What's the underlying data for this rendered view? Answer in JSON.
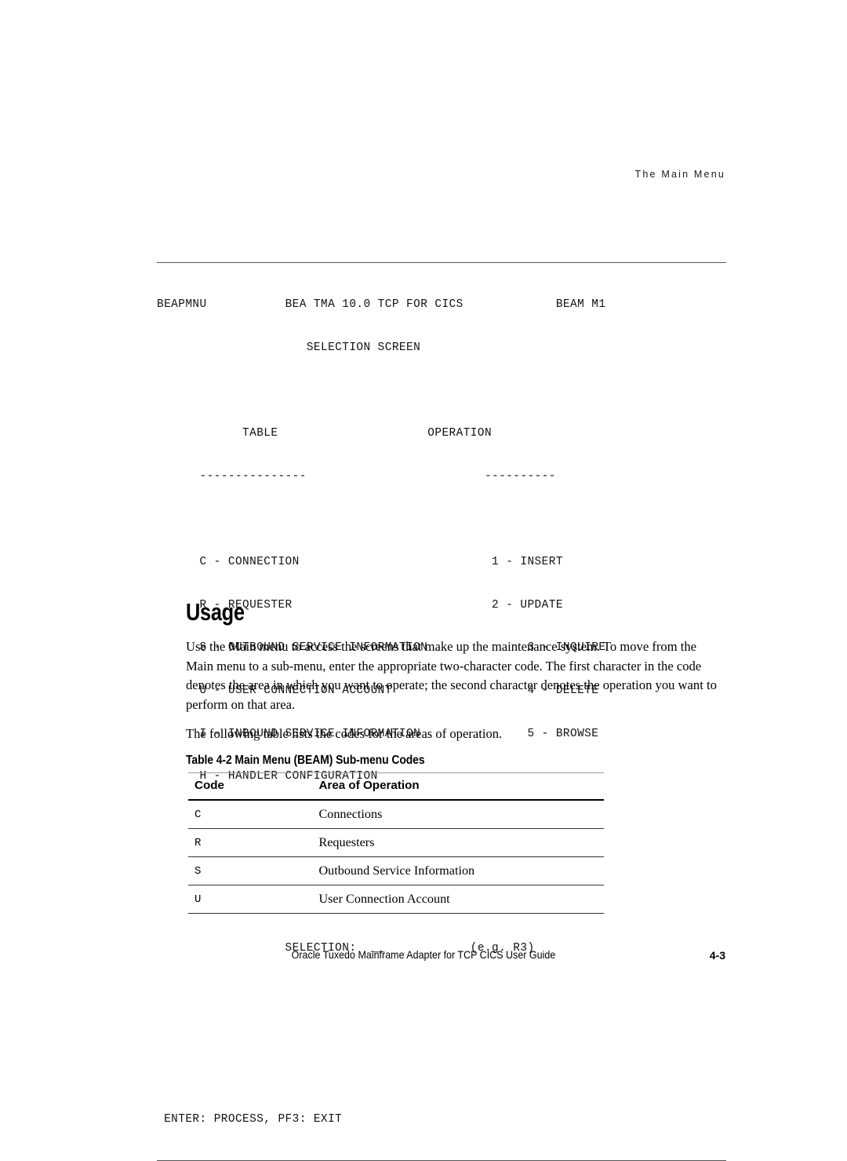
{
  "running_head": "The Main Menu",
  "terminal": {
    "header_left": "BEAPMNU",
    "header_center": "BEA TMA 10.0 TCP FOR CICS",
    "header_right": "BEAM M1",
    "subtitle": "SELECTION SCREEN",
    "col_table_heading": "TABLE",
    "col_operation_heading": "OPERATION",
    "col_table_rule": "---------------",
    "col_operation_rule": "----------",
    "table_options": [
      "C - CONNECTION",
      "R - REQUESTER",
      "S - OUTBOUND SERVICE INFORMATION",
      "U - USER CONNECTION ACCOUNT",
      "I - INBOUND SERVICE INFORMATION",
      "H - HANDLER CONFIGURATION"
    ],
    "operation_options": [
      "1 - INSERT",
      "2 - UPDATE",
      "3 - INQUIRE",
      "4 - DELETE",
      "5 - BROWSE"
    ],
    "selection_label": "SELECTION:",
    "selection_value": "__",
    "selection_hint": "(e.g. R3)",
    "function_keys": "ENTER: PROCESS, PF3: EXIT"
  },
  "usage": {
    "heading": "Usage",
    "paragraph_1": "Use the Main menu to access the screens that make up the maintenance system. To move from the Main menu to a sub-menu, enter the appropriate two-character code. The first character in the code denotes the area in which you want to operate; the second character denotes the operation you want to perform on that area.",
    "paragraph_2": "The following table lists the codes for the areas of operation."
  },
  "table_4_2": {
    "caption": "Table 4-2  Main Menu (BEAM) Sub-menu Codes",
    "headers": [
      "Code",
      "Area of Operation"
    ],
    "rows": [
      {
        "code": "C",
        "area": "Connections"
      },
      {
        "code": "R",
        "area": "Requesters"
      },
      {
        "code": "S",
        "area": "Outbound Service Information"
      },
      {
        "code": "U",
        "area": "User Connection Account"
      }
    ]
  },
  "footer": {
    "title": "Oracle Tuxedo Mainframe Adapter for TCP CICS User Guide",
    "page_number": "4-3"
  }
}
